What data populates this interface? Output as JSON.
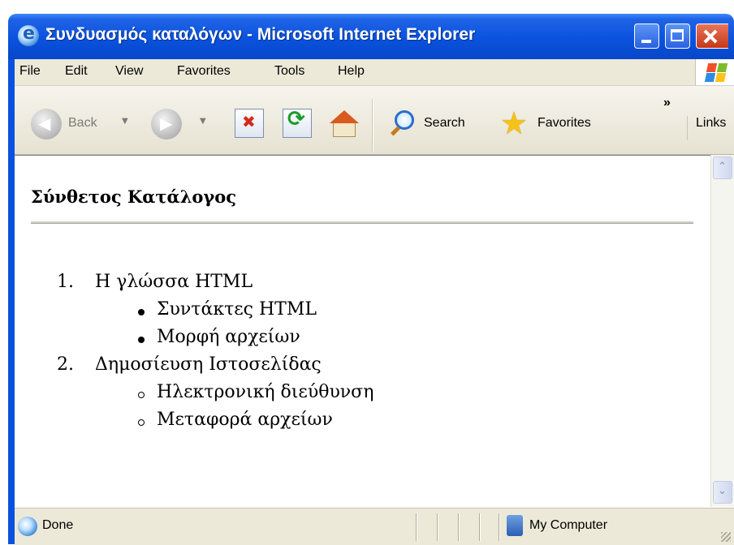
{
  "window": {
    "title": "Συνδυασμός καταλόγων - Microsoft Internet Explorer"
  },
  "menu": [
    "File",
    "Edit",
    "View",
    "Favorites",
    "Tools",
    "Help"
  ],
  "toolbar": {
    "back": "Back",
    "search": "Search",
    "favorites": "Favorites",
    "more": "»",
    "links": "Links"
  },
  "page": {
    "heading": "Σύνθετος Κατάλογος",
    "list": [
      {
        "number": "1.",
        "text": "Η γλώσσα HTML",
        "children": [
          "Συντάκτες HTML",
          "Μορφή αρχείων"
        ]
      },
      {
        "number": "2.",
        "text": "Δημοσίευση Ιστοσελίδας",
        "children": [
          "Ηλεκτρονική διεύθυνση",
          "Μεταφορά αρχείων"
        ]
      }
    ]
  },
  "status": {
    "text": "Done",
    "zone": "My Computer"
  },
  "colors": {
    "titlebar": "#0a52de",
    "chrome": "#ece9d8",
    "close_button": "#c5371a"
  }
}
